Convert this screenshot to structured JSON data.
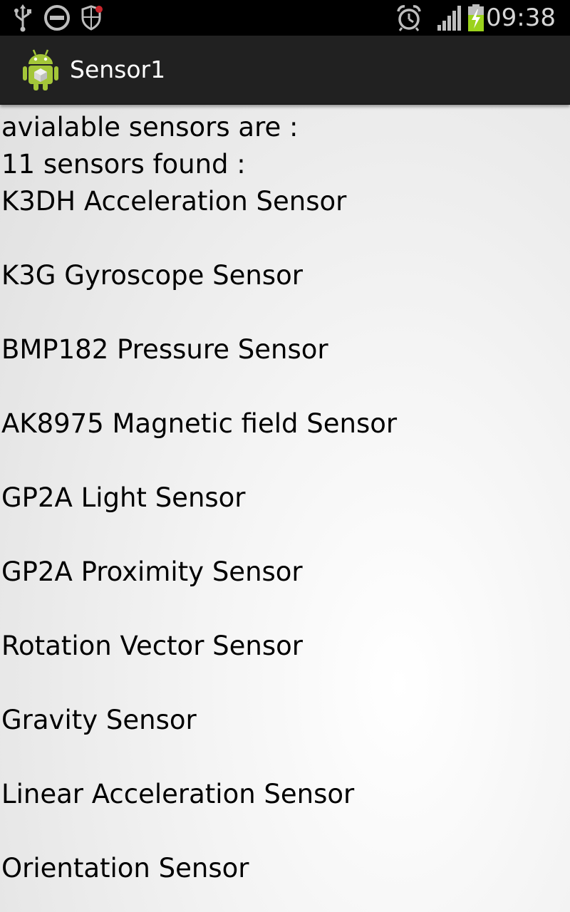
{
  "status_bar": {
    "time": "09:38",
    "icons": [
      "usb-icon",
      "do-not-disturb-icon",
      "security-shield-icon",
      "alarm-icon",
      "signal-icon",
      "battery-charging-icon"
    ],
    "icon_color": "#bdbdbd",
    "battery_color": "#9bd21c"
  },
  "action_bar": {
    "title": "Sensor1",
    "icon": "android-app-icon"
  },
  "content": {
    "header_line": "avialable sensors are :",
    "count_line": "11 sensors found :",
    "sensors": [
      "K3DH Acceleration Sensor",
      "K3G Gyroscope Sensor",
      "BMP182 Pressure Sensor",
      "AK8975 Magnetic field Sensor",
      "GP2A Light Sensor",
      "GP2A Proximity Sensor",
      "Rotation Vector Sensor",
      "Gravity Sensor",
      "Linear Acceleration Sensor",
      "Orientation Sensor"
    ]
  }
}
